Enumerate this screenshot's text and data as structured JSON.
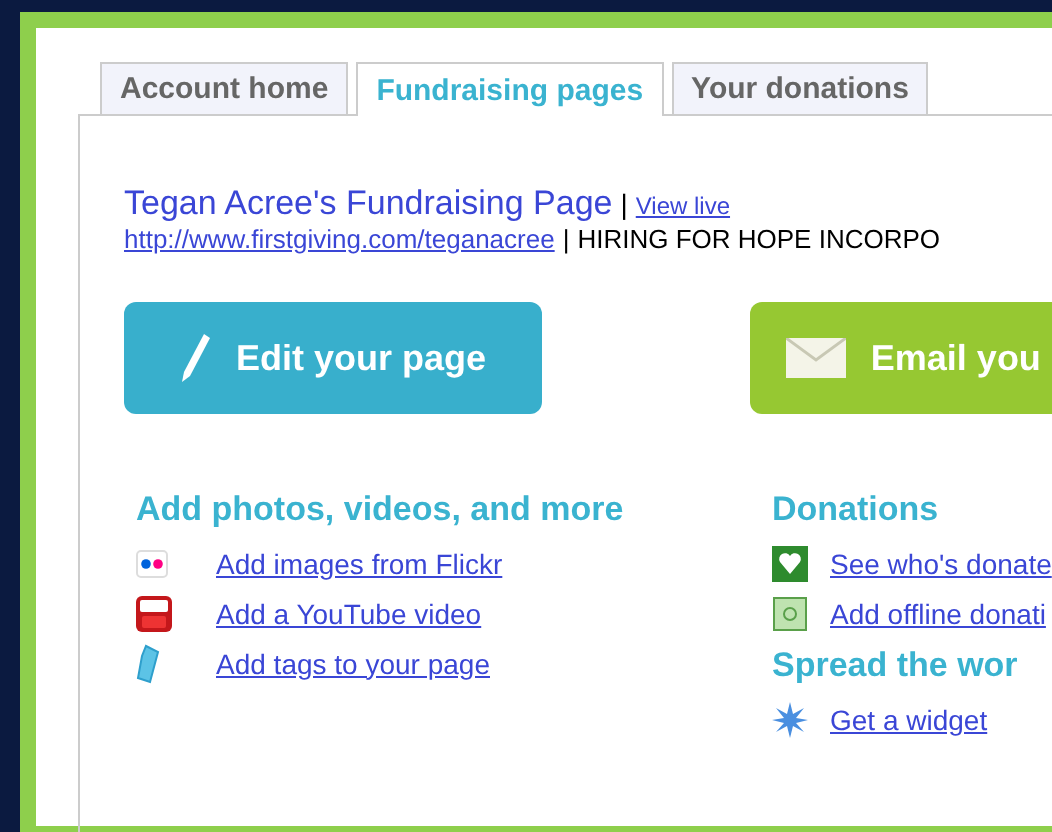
{
  "tabs": [
    {
      "label": "Account home",
      "selected": false
    },
    {
      "label": "Fundraising pages",
      "selected": true
    },
    {
      "label": "Your donations",
      "selected": false
    }
  ],
  "page": {
    "title": "Tegan Acree's Fundraising Page",
    "separator": "|",
    "view_link": "View live",
    "url": "http://www.firstgiving.com/teganacree",
    "url_separator": "|",
    "organization": "HIRING FOR HOPE INCORPO"
  },
  "buttons": [
    {
      "label": "Edit your page",
      "kind": "edit"
    },
    {
      "label": "Email you",
      "kind": "email"
    }
  ],
  "columns": [
    {
      "sections": [
        {
          "heading": "Add photos, videos, and more",
          "links": [
            {
              "label": "Add images from Flickr",
              "kind": "flickr"
            },
            {
              "label": "Add a YouTube video",
              "kind": "youtube"
            },
            {
              "label": "Add tags to your page",
              "kind": "tag"
            }
          ]
        }
      ]
    },
    {
      "sections": [
        {
          "heading": "Donations",
          "links": [
            {
              "label": "See who's donate",
              "kind": "heart"
            },
            {
              "label": "Add offline donati",
              "kind": "money"
            }
          ]
        },
        {
          "heading": "Spread the wor",
          "links": [
            {
              "label": "Get a widget",
              "kind": "star"
            }
          ]
        }
      ]
    }
  ]
}
